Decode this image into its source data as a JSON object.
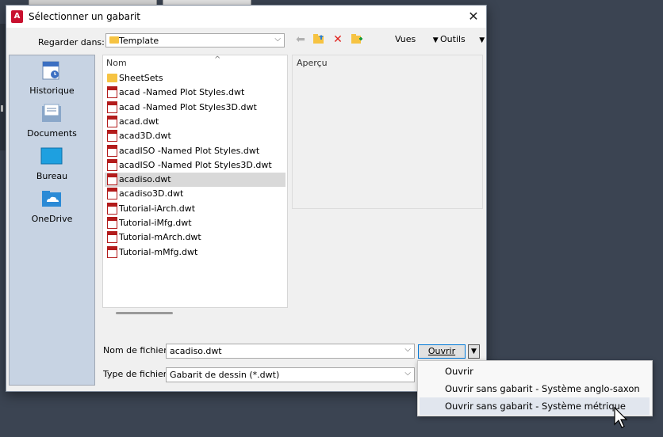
{
  "dialog": {
    "title": "Sélectionner un gabarit",
    "look_in_label": "Regarder dans:",
    "look_in_value": "Template",
    "views_label": "Vues",
    "tools_label": "Outils",
    "name_column": "Nom",
    "preview_label": "Aperçu",
    "filename_label": "Nom de fichier:",
    "filename_value": "acadiso.dwt",
    "filetype_label": "Type de fichier:",
    "filetype_value": "Gabarit de dessin (*.dwt)",
    "open_button": "Ouvrir",
    "app_icon_letter": "A"
  },
  "places": [
    {
      "label": "Historique",
      "icon": "history-icon"
    },
    {
      "label": "Documents",
      "icon": "documents-icon"
    },
    {
      "label": "Bureau",
      "icon": "desktop-icon"
    },
    {
      "label": "OneDrive",
      "icon": "onedrive-icon"
    }
  ],
  "files": [
    {
      "name": "SheetSets",
      "type": "folder"
    },
    {
      "name": "acad -Named Plot Styles.dwt",
      "type": "dwt"
    },
    {
      "name": "acad -Named Plot Styles3D.dwt",
      "type": "dwt"
    },
    {
      "name": "acad.dwt",
      "type": "dwt"
    },
    {
      "name": "acad3D.dwt",
      "type": "dwt"
    },
    {
      "name": "acadISO -Named Plot Styles.dwt",
      "type": "dwt"
    },
    {
      "name": "acadISO -Named Plot Styles3D.dwt",
      "type": "dwt"
    },
    {
      "name": "acadiso.dwt",
      "type": "dwt",
      "selected": true
    },
    {
      "name": "acadiso3D.dwt",
      "type": "dwt"
    },
    {
      "name": "Tutorial-iArch.dwt",
      "type": "dwt"
    },
    {
      "name": "Tutorial-iMfg.dwt",
      "type": "dwt"
    },
    {
      "name": "Tutorial-mArch.dwt",
      "type": "dwt"
    },
    {
      "name": "Tutorial-mMfg.dwt",
      "type": "dwt"
    }
  ],
  "open_menu": {
    "items": [
      {
        "label": "Ouvrir"
      },
      {
        "label": "Ouvrir sans gabarit - Système anglo-saxon"
      },
      {
        "label": "Ouvrir sans gabarit - Système métrique",
        "highlighted": true
      }
    ]
  },
  "colors": {
    "accent": "#0078d7",
    "selection": "#d9d9d9",
    "dwt_red": "#b31b1b",
    "folder": "#f6c342"
  }
}
